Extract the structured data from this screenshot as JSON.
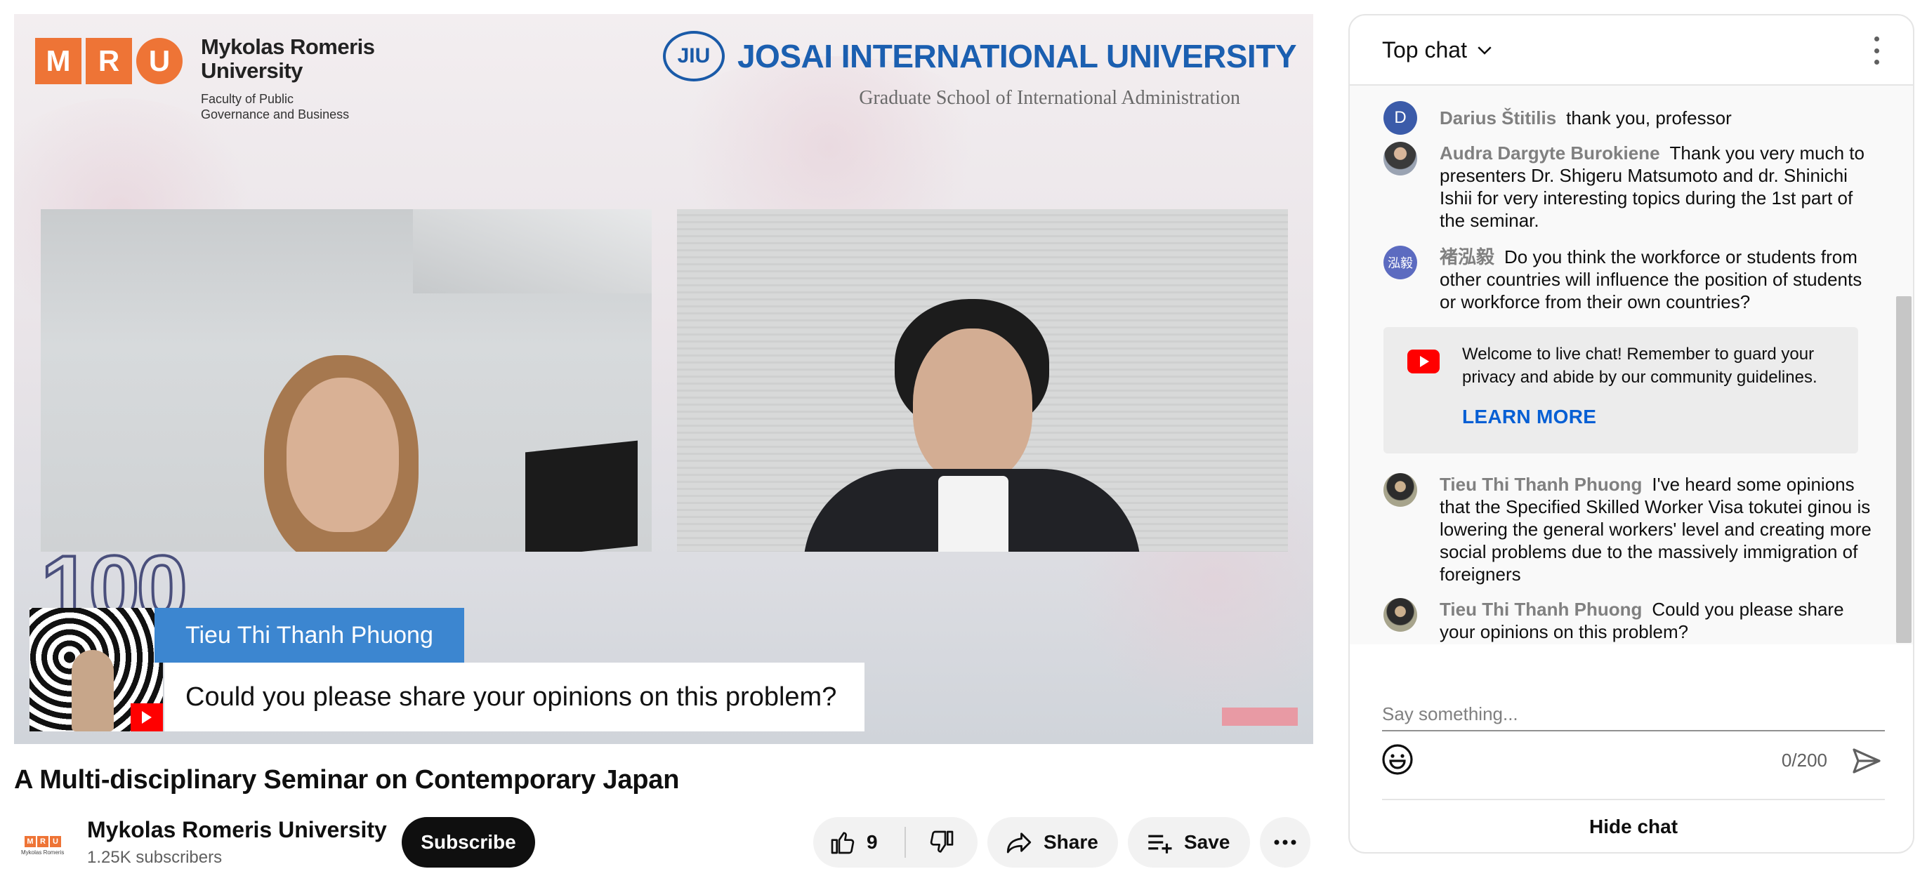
{
  "video": {
    "mru_letters": [
      "M",
      "R",
      "U"
    ],
    "mru_name_line1": "Mykolas Romeris",
    "mru_name_line2": "University",
    "mru_faculty_line1": "Faculty of Public",
    "mru_faculty_line2": "Governance and Business",
    "jiu_seal": "JIU",
    "jiu_name": "JOSAI INTERNATIONAL UNIVERSITY",
    "jiu_sub": "Graduate School of International Administration",
    "hundred": "100",
    "lower_third_name": "Tieu Thi Thanh Phuong",
    "lower_third_quote": "Could you please share your opinions on this problem?"
  },
  "title": "A Multi-disciplinary Seminar on Contemporary Japan",
  "channel": {
    "avatar_letters": [
      "M",
      "R",
      "U"
    ],
    "name": "Mykolas Romeris University",
    "subscribers": "1.25K subscribers",
    "subscribe_label": "Subscribe"
  },
  "actions": {
    "like_count": "9",
    "share_label": "Share",
    "save_label": "Save"
  },
  "chat": {
    "mode_label": "Top chat",
    "messages": [
      {
        "avatar": "D",
        "avatar_color": "#3b5ba9",
        "author": "Darius Štitilis",
        "text": "thank you, professor"
      },
      {
        "avatar": "",
        "avatar_color": "#5a4a3e",
        "author": "Audra Dargyte Burokiene",
        "text": "Thank you very much to presenters Dr. Shigeru Matsumoto and dr. Shinichi Ishii for very interesting topics during the 1st part of the seminar."
      },
      {
        "avatar": "泓毅",
        "avatar_color": "#5c6bc0",
        "author": "褚泓毅",
        "text": "Do you think the workforce or students from other countries will influence the position of students or workforce from their own countries?"
      },
      {
        "avatar": "",
        "avatar_color": "#6d6d5a",
        "author": "Tieu Thi Thanh Phuong",
        "text": "I've heard some opinions that the Specified Skilled Worker Visa tokutei ginou is lowering the general workers' level and creating more social problems due to the massively immigration of foreigners"
      },
      {
        "avatar": "",
        "avatar_color": "#6d6d5a",
        "author": "Tieu Thi Thanh Phuong",
        "text": "Could you please share your opinions on this problem?"
      }
    ],
    "welcome_text": "Welcome to live chat! Remember to guard your privacy and abide by our community guidelines.",
    "learn_more": "LEARN MORE",
    "input_placeholder": "Say something...",
    "char_count": "0/200",
    "hide_chat": "Hide chat"
  },
  "colors": {
    "mru_orange": "#ee7436",
    "jiu_blue": "#1b5fb0",
    "name_tag_blue": "#3c86d0",
    "link_blue": "#065fd4",
    "youtube_red": "#ff0000"
  }
}
